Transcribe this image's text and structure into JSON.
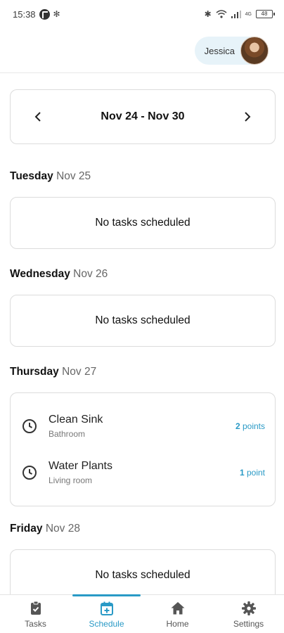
{
  "status_bar": {
    "time": "15:38",
    "network": "4G",
    "battery": "48"
  },
  "header": {
    "user_name": "Jessica"
  },
  "week_nav": {
    "range": "Nov 24 - Nov 30"
  },
  "days": [
    {
      "weekday": "Tuesday",
      "date": "Nov 25",
      "empty_text": "No tasks scheduled"
    },
    {
      "weekday": "Wednesday",
      "date": "Nov 26",
      "empty_text": "No tasks scheduled"
    },
    {
      "weekday": "Thursday",
      "date": "Nov 27",
      "tasks": [
        {
          "title": "Clean Sink",
          "room": "Bathroom",
          "points_value": "2",
          "points_unit": "points"
        },
        {
          "title": "Water Plants",
          "room": "Living room",
          "points_value": "1",
          "points_unit": "point"
        }
      ]
    },
    {
      "weekday": "Friday",
      "date": "Nov 28",
      "empty_text": "No tasks scheduled"
    }
  ],
  "tabs": [
    {
      "label": "Tasks",
      "icon": "clipboard-check-icon"
    },
    {
      "label": "Schedule",
      "icon": "calendar-plus-icon",
      "active": true
    },
    {
      "label": "Home",
      "icon": "home-icon"
    },
    {
      "label": "Settings",
      "icon": "gear-icon"
    }
  ],
  "colors": {
    "accent": "#2a9ac6",
    "chip_bg": "#e7f3f9",
    "border": "#dcdcdc"
  }
}
